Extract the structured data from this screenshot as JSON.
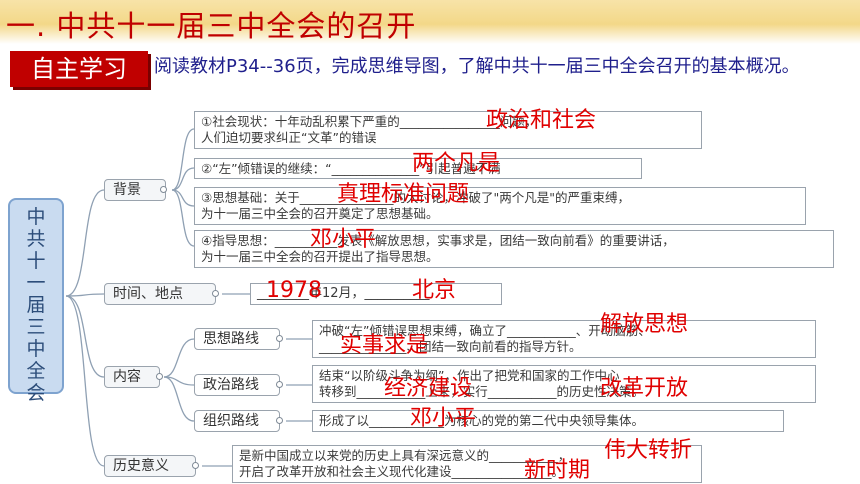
{
  "title": "一. 中共十一届三中全会的召开",
  "self_study_label": "自主学习",
  "instructions": "阅读教材P34--36页，完成思维导图，了解中共十一届三中全会召开的基本概况。",
  "root": [
    "中",
    "共",
    "十",
    "一",
    "届",
    "三",
    "中",
    "全",
    "会"
  ],
  "branches": {
    "background": "背景",
    "time_place": "时间、地点",
    "content": "内容",
    "significance": "历史意义"
  },
  "background_items": [
    {
      "line1": "①社会现状：十年动乱积累下严重的________________问题，",
      "line2": "人们迫切要求纠正“文革”的错误",
      "answer": "政治和社会"
    },
    {
      "line1": "②“左”倾错误的继续：“______________”引起普遍不满",
      "answer": "两个凡是"
    },
    {
      "line1": "③思想基础：关于_______________的大讨论，冲破了\"两个凡是\"的严重束缚，",
      "line2": "为十一届三中全会的召开奠定了思想基础。",
      "answer": "真理标准问题"
    },
    {
      "line1": "④指导思想：__________发表《解放思想，实事求是，团结一致向前看》的重要讲话，",
      "line2": "为十一届三中全会的召开提出了指导思想。",
      "answer": "邓小平"
    }
  ],
  "time_place": {
    "text": "________年12月，__________",
    "answer_year": "1978",
    "answer_place": "北京"
  },
  "content_items": {
    "ideological_label": "思想路线",
    "ideological_line1": "冲破“左”倾错误思想束缚，确立了___________、开动脑筋、",
    "ideological_line2": "______________、团结一致向前看的指导方针。",
    "ideological_answer1": "解放思想",
    "ideological_answer2": "实事求是",
    "political_label": "政治路线",
    "political_line1": "结束“以阶级斗争为纲”，作出了把党和国家的工作中心",
    "political_line2": "转移到___________上来，实行___________的历史性决策。",
    "political_answer1": "经济建设",
    "political_answer2": "改革开放",
    "organizational_label": "组织路线",
    "organizational_line1": "形成了以____________为核心的党的第二代中央领导集体。",
    "organizational_answer": "邓小平"
  },
  "significance": {
    "line1": "是新中国成立以来党的历史上具有深远意义的___________，",
    "line2": "开启了改革开放和社会主义现代化建设________________。",
    "answer1": "伟大转折",
    "answer2": "新时期"
  }
}
